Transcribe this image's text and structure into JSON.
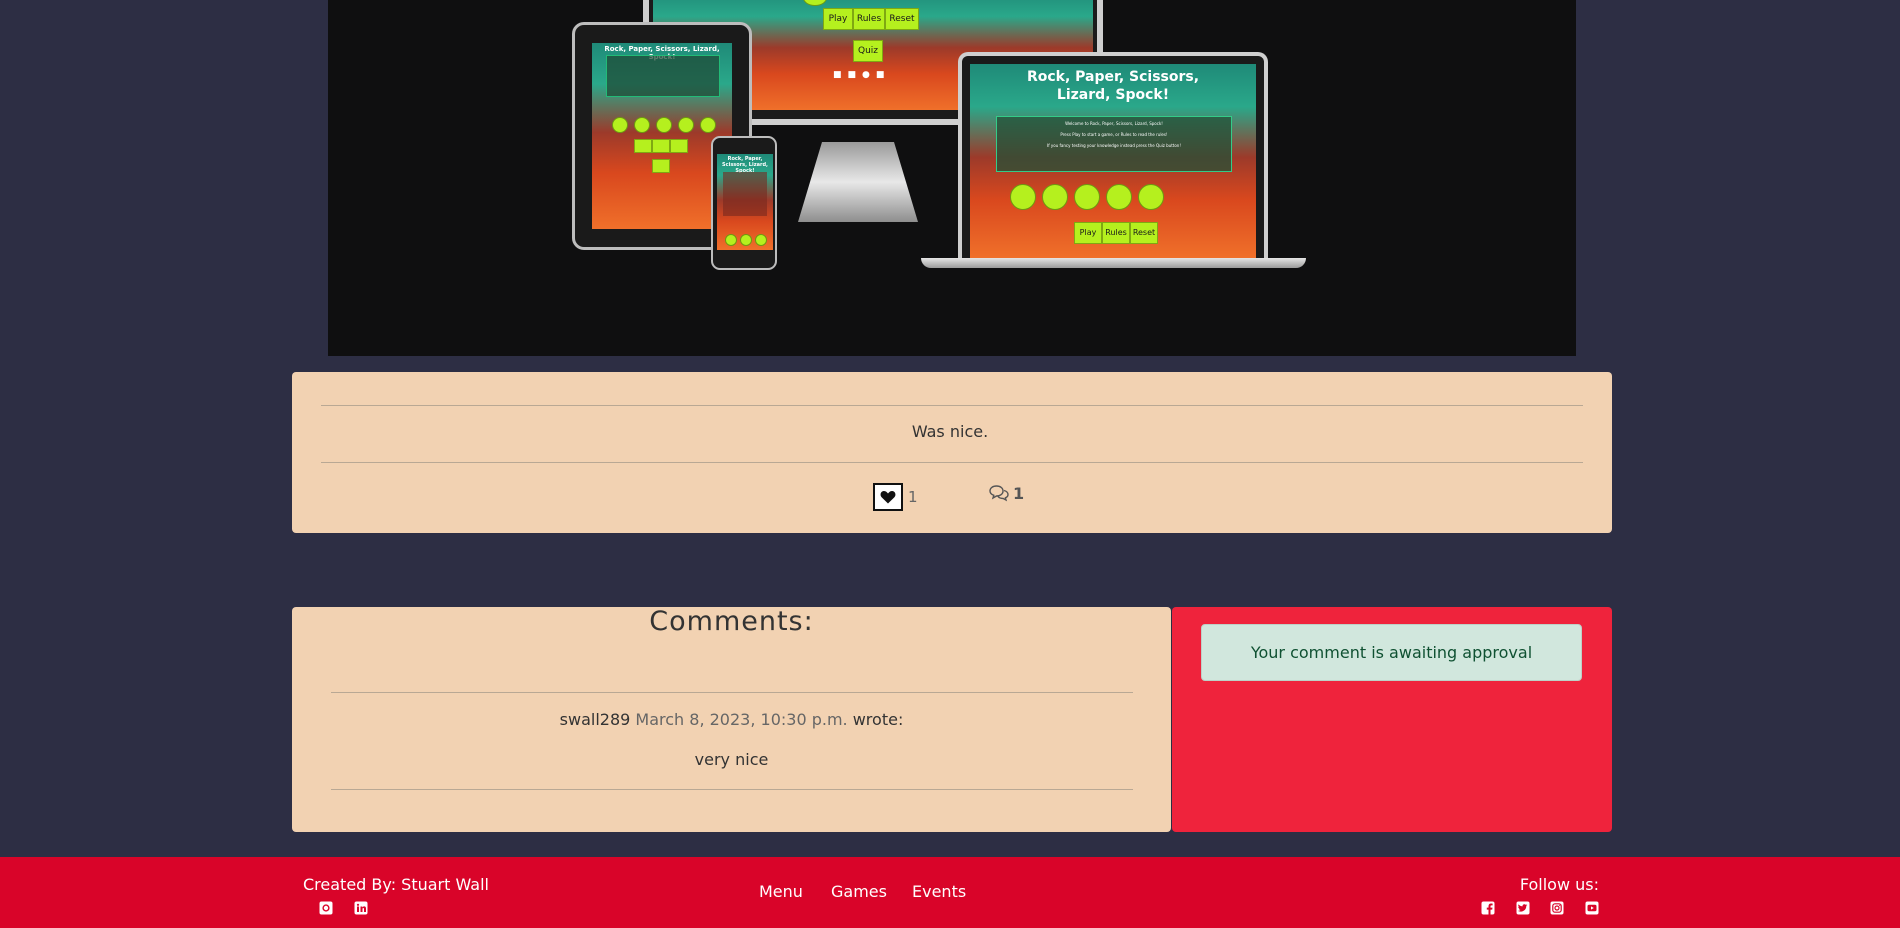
{
  "hero": {
    "device_title": "Rock, Paper, Scissors, Lizard, Spock!",
    "tablet_title": "Rock, Paper, Scissors, Lizard, Spock!",
    "phone_title": "Rock, Paper, Scissors, Lizard, Spock!",
    "intro_line1": "Welcome to Rock, Paper, Scissors, Lizard, Spock!",
    "intro_line2": "Press Play to start a game, or Rules to read the rules!",
    "intro_line3": "If you fancy testing your knowledge instead press the Quiz button!",
    "buttons": {
      "play": "Play",
      "rules": "Rules",
      "reset": "Reset",
      "quiz": "Quiz"
    }
  },
  "post": {
    "content": "Was nice.",
    "like_count": "1",
    "comment_count": "1"
  },
  "comments": {
    "heading": "Comments:",
    "items": [
      {
        "author": "swall289",
        "date": "March 8, 2023, 10:30 p.m.",
        "suffix": "wrote:",
        "body": "very nice"
      }
    ]
  },
  "notice": {
    "message": "Your comment is awaiting approval"
  },
  "footer": {
    "created_by": "Created By: Stuart Wall",
    "follow_us": "Follow us:",
    "nav": [
      "Menu",
      "Games",
      "Events"
    ]
  },
  "colors": {
    "page_bg": "#2d2e44",
    "card_bg": "#f2d2b2",
    "side_card_bg": "#ef233c",
    "footer_bg": "#d90429",
    "alert_bg": "#d1e7dd",
    "button_green": "#b5f01e"
  },
  "icons": {
    "footer_left": [
      "github-icon",
      "linkedin-icon"
    ],
    "footer_right": [
      "facebook-icon",
      "twitter-icon",
      "instagram-icon",
      "youtube-icon"
    ],
    "like": "heart-icon",
    "comment": "comments-icon"
  }
}
